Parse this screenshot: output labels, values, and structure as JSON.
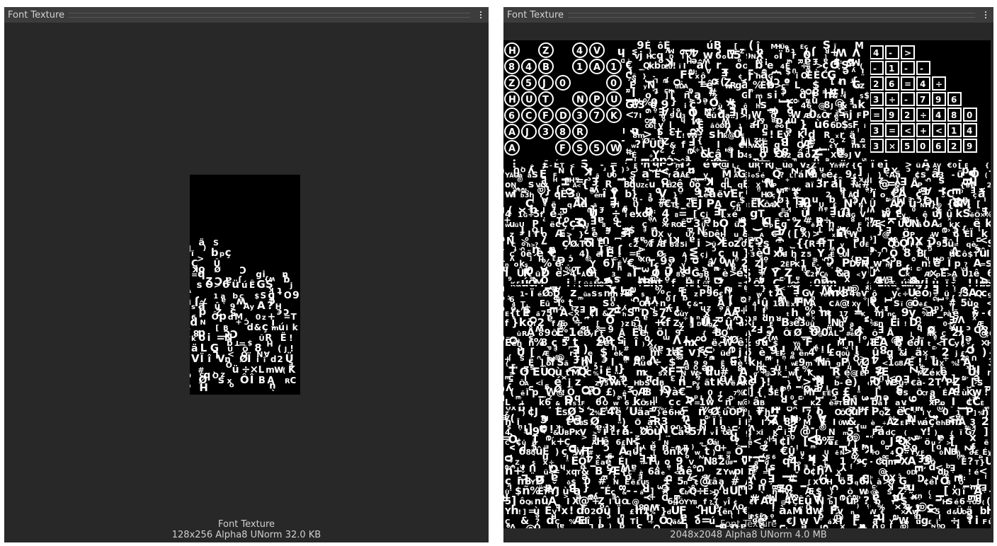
{
  "panels": [
    {
      "title": "Font Texture",
      "info_name": "Font Texture",
      "info_details": "128x256  Alpha8 UNorm  32.0 KB"
    },
    {
      "title": "Font Texture",
      "info_name": "Font Texture",
      "info_details": "2048x2048  Alpha8 UNorm  4.0 MB"
    }
  ],
  "icons": {
    "menu": "kebab-menu-icon"
  },
  "colors": {
    "panel_bg": "#282828",
    "titlebar_bg": "#3c3c3c",
    "texture_bg": "#000000",
    "glyph": "#ffffff"
  }
}
